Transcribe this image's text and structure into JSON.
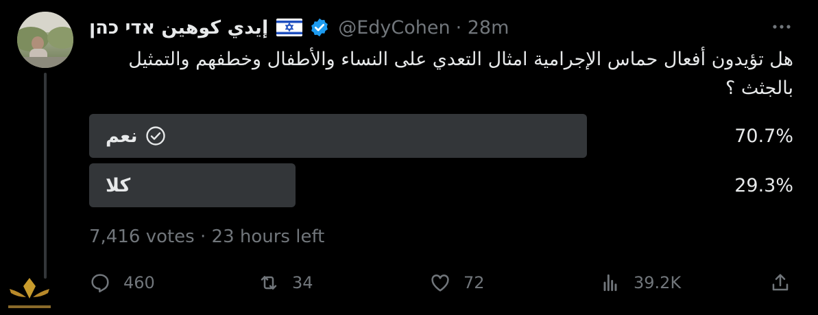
{
  "tweet": {
    "author_name": "إيدي كوهين אדי כהן",
    "handle": "@EdyCohen",
    "time": "· 28m",
    "text": "هل تؤيدون أفعال حماس الإجرامية امثال التعدي على النساء والأطفال وخطفهم والتمثيل  بالجثث ؟"
  },
  "poll": {
    "options": [
      {
        "label": "نعم",
        "percent_text": "70.7%",
        "percent": 70.7,
        "winner": true
      },
      {
        "label": "كلا",
        "percent_text": "29.3%",
        "percent": 29.3,
        "winner": false
      }
    ],
    "meta": "7,416 votes · 23 hours left"
  },
  "actions": {
    "replies": "460",
    "retweets": "34",
    "likes": "72",
    "views": "39.2K"
  },
  "icons": {
    "verified": "verified-badge-icon",
    "flag": "israel-flag-icon",
    "more": "more-icon",
    "reply": "reply-icon",
    "retweet": "retweet-icon",
    "like": "like-icon",
    "views": "views-icon",
    "share": "share-icon",
    "check": "check-circle-icon"
  },
  "colors": {
    "background": "#000000",
    "text": "#e7e9ea",
    "muted": "#71767b",
    "bar": "#333639",
    "verified": "#1d9bf0"
  }
}
